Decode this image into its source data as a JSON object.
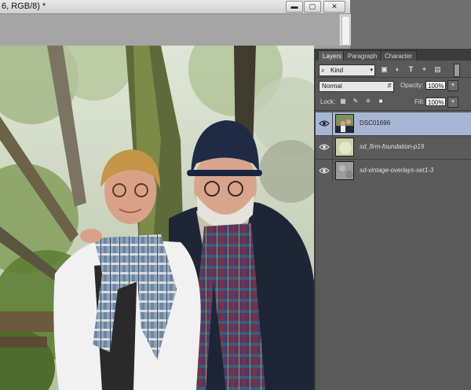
{
  "document": {
    "title": "6, RGB/8) *",
    "window_buttons": {
      "minimize": "▬",
      "restore": "▢",
      "close": "✕"
    }
  },
  "panel": {
    "tabs": [
      {
        "label": "Layers",
        "active": true
      },
      {
        "label": "Paragraph",
        "active": false
      },
      {
        "label": "Character",
        "active": false
      }
    ],
    "filter": {
      "kind_label": "Kind",
      "icons": [
        "image-filter-icon",
        "adjustment-filter-icon",
        "type-filter-icon",
        "shape-filter-icon",
        "smart-object-filter-icon"
      ]
    },
    "blend_mode": "Normal",
    "opacity_label": "Opacity:",
    "opacity_value": "100%",
    "lock_label": "Lock:",
    "fill_label": "Fill:",
    "fill_value": "100%"
  },
  "layers": [
    {
      "name": "DSC01696",
      "selected": true,
      "visible": true
    },
    {
      "name": "sd_firm-foundation-p19",
      "selected": false,
      "visible": true
    },
    {
      "name": "sd-vintage-overlays-set1-3",
      "selected": false,
      "visible": true
    }
  ],
  "colors": {
    "selection": "#a7b6d4",
    "panel_bg": "#595959",
    "chrome": "#d9d9d9"
  }
}
